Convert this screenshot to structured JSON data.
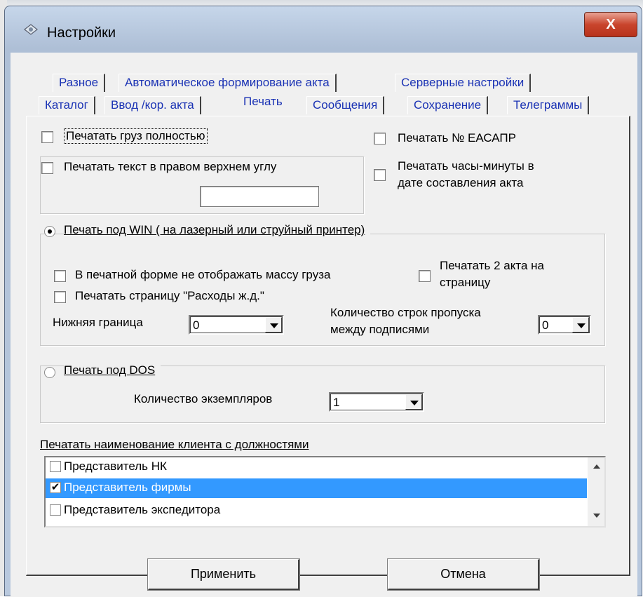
{
  "window": {
    "title": "Настройки",
    "close_glyph": "X"
  },
  "tabs": {
    "row1": [
      "Разное",
      "Автоматическое формирование акта",
      "Серверные настройки"
    ],
    "row2": [
      "Каталог",
      "Ввод /кор. акта",
      "Печать",
      "Сообщения",
      "Сохранение",
      "Телеграммы"
    ],
    "active": "Печать"
  },
  "print_tab": {
    "print_cargo_full": {
      "label": "Печатать груз полностью",
      "checked": false
    },
    "print_eacapr": {
      "label": "Печатать № ЕАСАПР",
      "checked": false
    },
    "print_top_right_text": {
      "label": "Печатать текст в правом верхнем углу",
      "checked": false,
      "value": ""
    },
    "print_hours_minutes": {
      "line1": "Печатать часы-минуты в",
      "line2": "дате составления акта",
      "checked": false
    },
    "win_print": {
      "label": "Печать под WIN ( на лазерный или струйный принтер)",
      "selected": true,
      "hide_cargo_mass": {
        "label": "В печатной форме не отображать массу груза",
        "checked": false
      },
      "two_acts": {
        "line1": "Печатать 2 акта на",
        "line2": "страницу",
        "checked": false
      },
      "print_rail_expenses": {
        "label": "Печатать страницу \"Расходы ж.д.\"",
        "checked": false
      },
      "bottom_margin": {
        "label": "Нижняя граница",
        "value": "0"
      },
      "skip_lines": {
        "line1": "Количество строк пропуска",
        "line2": "между подписями",
        "value": "0"
      }
    },
    "dos_print": {
      "label": "Печать под DOS",
      "selected": false,
      "copies": {
        "label": "Количество экземпляров",
        "value": "1"
      }
    },
    "client_roles": {
      "label": "Печатать наименование клиента с должностями",
      "items": [
        {
          "label": "Представитель НК",
          "checked": false,
          "selected": false
        },
        {
          "label": "Представитель фирмы",
          "checked": true,
          "selected": true
        },
        {
          "label": "Представитель экспедитора",
          "checked": false,
          "selected": false
        }
      ]
    }
  },
  "buttons": {
    "apply": "Применить",
    "cancel": "Отмена"
  },
  "colors": {
    "tab_text": "#1a32b4",
    "selection": "#3399ff",
    "close_button": "#c9452d"
  }
}
